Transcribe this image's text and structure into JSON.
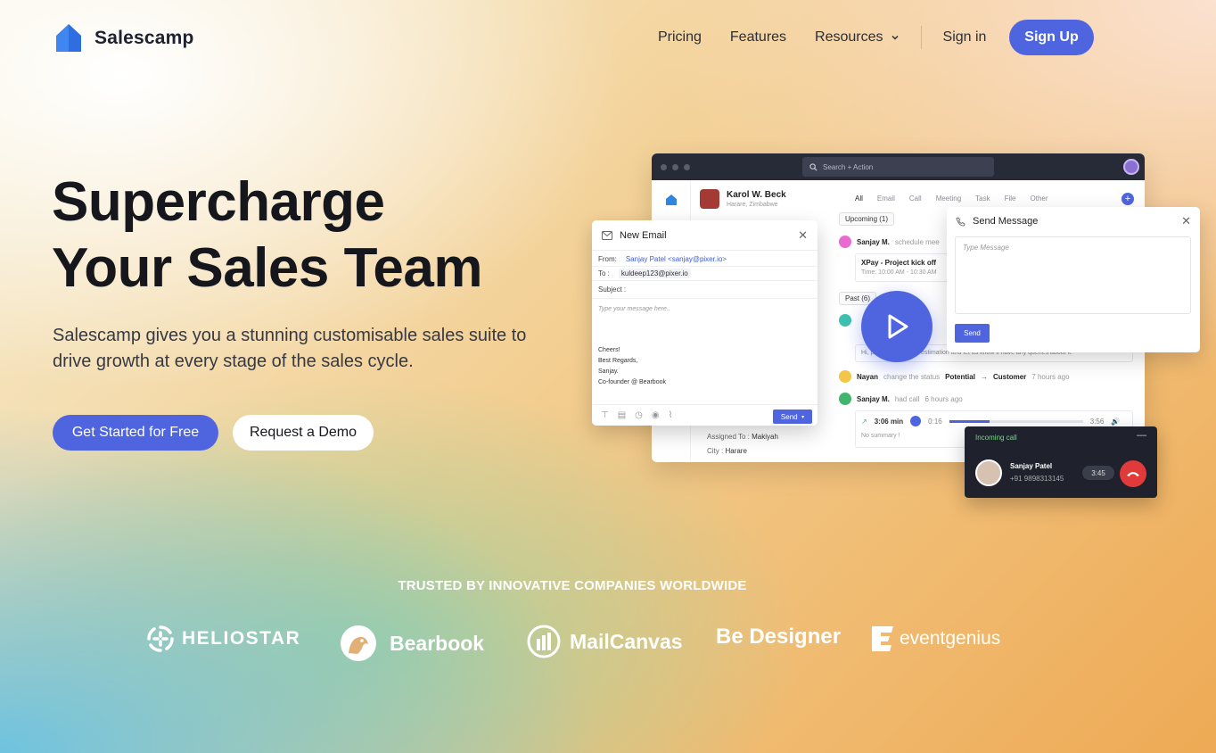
{
  "nav": {
    "brand": "Salescamp",
    "links": [
      "Pricing",
      "Features",
      "Resources"
    ],
    "sign_in": "Sign in",
    "sign_up": "Sign Up"
  },
  "hero": {
    "title_line1": "Supercharge",
    "title_line2": "Your Sales Team",
    "subtitle": "Salescamp gives you a stunning customisable sales suite to drive growth at every stage of the sales cycle.",
    "cta_primary": "Get Started for Free",
    "cta_secondary": "Request a Demo"
  },
  "app": {
    "search": "Search + Action",
    "contact_name": "Karol W. Beck",
    "contact_location": "Harare, Zimbabwe",
    "tabs": [
      "All",
      "Email",
      "Call",
      "Meeting",
      "Task",
      "File",
      "Other"
    ],
    "upcoming": "Upcoming (1)",
    "past": "Past (6)",
    "upcoming_item": {
      "who": "Sanjay M.",
      "action": "schedule mee"
    },
    "meeting_title": "XPay - Project kick off",
    "meeting_time": "Time: 10:00 AM - 10:30 AM",
    "estimation_text": "Hi, please review the estimation and let us know if have any queries about it.",
    "status_item": {
      "who": "Nayan",
      "action": "change the status",
      "from": "Potential",
      "to": "Customer",
      "time": "7 hours ago"
    },
    "call_item": {
      "who": "Sanjay M.",
      "action": "had call",
      "time": "6 hours ago"
    },
    "call_duration": "3:06 min",
    "call_pos": "0:16",
    "call_total": "3:56",
    "call_progress": 0.3,
    "no_summary": "No summary !",
    "assigned_label": "Assigned To :",
    "assigned_value": "Makiyah",
    "city_label": "City :",
    "city_value": "Harare"
  },
  "email": {
    "title": "New Email",
    "from_label": "From:",
    "from_value": "Sanjay Patel <sanjay@pixer.io>",
    "to_label": "To :",
    "to_value": "kuldeep123@pixer.io",
    "subject_label": "Subject :",
    "body_placeholder": "Type your message here..",
    "sig1": "Cheers!",
    "sig2": "Best Regards,",
    "sig3": "Sanjay.",
    "sig4": "Co-founder @ Bearbook",
    "send": "Send"
  },
  "send_message": {
    "title": "Send Message",
    "placeholder": "Type Message",
    "send": "Send"
  },
  "incoming_call": {
    "label": "Incoming call",
    "name": "Sanjay Patel",
    "number": "+91 9898313145",
    "timer": "3:45"
  },
  "trusted": {
    "heading": "TRUSTED BY INNOVATIVE COMPANIES WORLDWIDE",
    "logos": [
      "HELIOSTAR",
      "Bearbook",
      "MailCanvas",
      "Be Designer",
      "eventgenius"
    ]
  },
  "colors": {
    "accent": "#4f65e0",
    "dark": "#15171d"
  }
}
